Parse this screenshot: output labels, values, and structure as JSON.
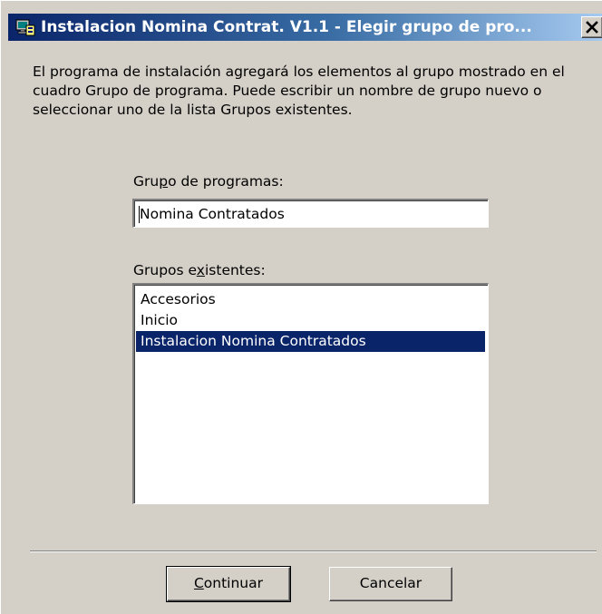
{
  "window": {
    "title": "Instalacion Nomina Contrat. V1.1 - Elegir grupo de pro...",
    "close_label": "Close"
  },
  "description": "El programa de instalación agregará los elementos al grupo mostrado en el cuadro Grupo de programa. Puede escribir un nombre de grupo nuevo o seleccionar uno de la lista Grupos existentes.",
  "program_group": {
    "label_parts": [
      "Gru",
      "p",
      "o de programas:"
    ],
    "value": "Nomina Contratados"
  },
  "existing_groups": {
    "label_parts": [
      "Grupos e",
      "x",
      "istentes:"
    ],
    "items": [
      "Accesorios",
      "Inicio",
      "Instalacion Nomina Contratados"
    ],
    "selected_index": 2
  },
  "buttons": {
    "continue_parts": [
      "C",
      "ontinuar"
    ],
    "cancel": "Cancelar"
  },
  "colors": {
    "face": "#d4d0c8",
    "titlebar_start": "#0a246a",
    "titlebar_end": "#a6caf0",
    "selection": "#0a246a"
  }
}
